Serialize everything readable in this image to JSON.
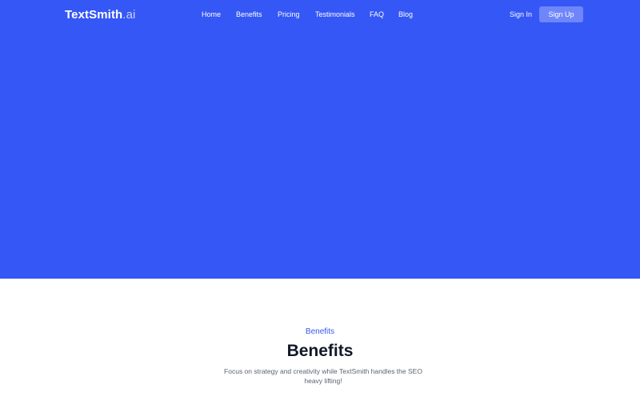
{
  "brand": {
    "name": "TextSmith",
    "suffix": ".ai"
  },
  "nav": {
    "items": [
      "Home",
      "Benefits",
      "Pricing",
      "Testimonials",
      "FAQ",
      "Blog"
    ]
  },
  "auth": {
    "sign_in": "Sign In",
    "sign_up": "Sign Up"
  },
  "benefits": {
    "eyebrow": "Benefits",
    "heading": "Benefits",
    "description": "Focus on strategy and creativity while TextSmith handles the SEO heavy lifting!"
  },
  "colors": {
    "accent": "#3557f5",
    "button": "#6f86fb",
    "heading": "#111827",
    "body_text": "#5b6472"
  }
}
